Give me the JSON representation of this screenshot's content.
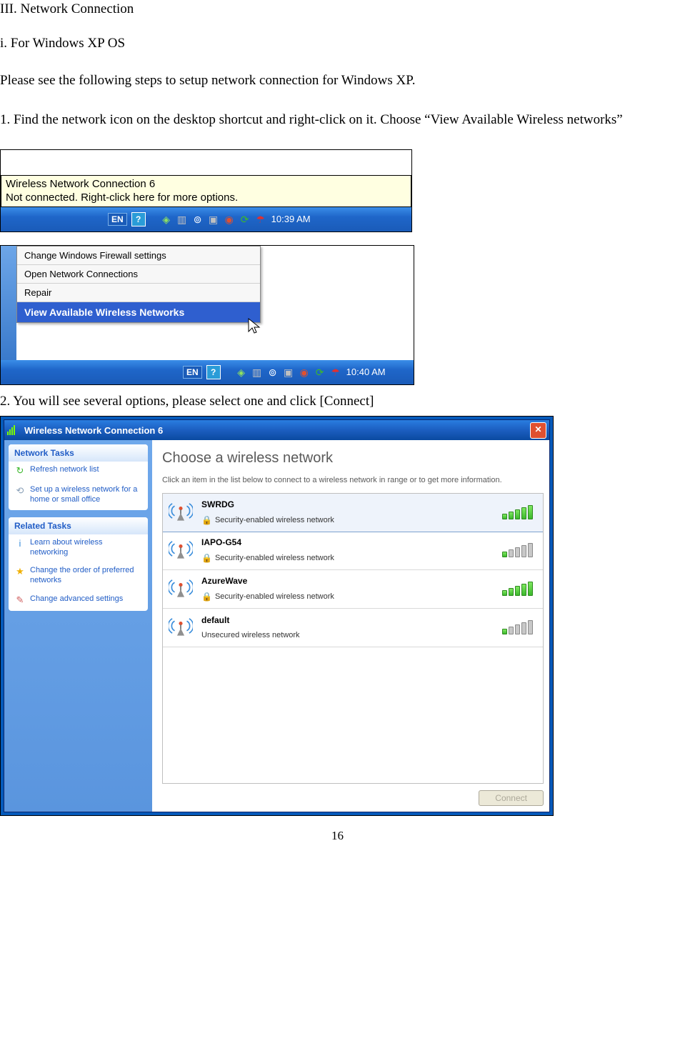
{
  "heading": "III. Network Connection",
  "sub": "i. For Windows XP OS",
  "intro": "Please see the following steps to setup network connection for Windows XP.",
  "step1": "1. Find the network icon on the desktop shortcut and right-click on it. Choose “View Available Wireless networks”",
  "shot1": {
    "tooltip_l1": "Wireless Network Connection 6",
    "tooltip_l2": "Not connected. Right-click here for more options.",
    "lang": "EN",
    "help": "?",
    "time": "10:39 AM"
  },
  "shot2": {
    "items": [
      "Change Windows Firewall settings",
      "Open Network Connections",
      "Repair",
      "View Available Wireless Networks"
    ],
    "lang": "EN",
    "help": "?",
    "time": "10:40 AM"
  },
  "step2": "2. You will see several options, please select one and click [Connect]",
  "win": {
    "title": "Wireless Network Connection 6",
    "side1_title": "Network Tasks",
    "side1": [
      {
        "icon": "↻",
        "color": "#3cb82c",
        "text": "Refresh network list"
      },
      {
        "icon": "⟲",
        "color": "#8aa0b8",
        "text": "Set up a wireless network for a home or small office"
      }
    ],
    "side2_title": "Related Tasks",
    "side2": [
      {
        "icon": "i",
        "color": "#3a8ddb",
        "text": "Learn about wireless networking"
      },
      {
        "icon": "★",
        "color": "#f0b000",
        "text": "Change the order of preferred networks"
      },
      {
        "icon": "✎",
        "color": "#d06060",
        "text": "Change advanced settings"
      }
    ],
    "choose_title": "Choose a wireless network",
    "choose_sub": "Click an item in the list below to connect to a wireless network in range or to get more information.",
    "networks": [
      {
        "name": "SWRDG",
        "secure": true,
        "sec_text": "Security-enabled wireless network",
        "signal": 5,
        "sel": true
      },
      {
        "name": "IAPO-G54",
        "secure": true,
        "sec_text": "Security-enabled wireless network",
        "signal": 1,
        "sel": false
      },
      {
        "name": "AzureWave",
        "secure": true,
        "sec_text": "Security-enabled wireless network",
        "signal": 5,
        "sel": false
      },
      {
        "name": "default",
        "secure": false,
        "sec_text": "Unsecured wireless network",
        "signal": 1,
        "sel": false
      }
    ],
    "connect": "Connect"
  },
  "page": "16"
}
